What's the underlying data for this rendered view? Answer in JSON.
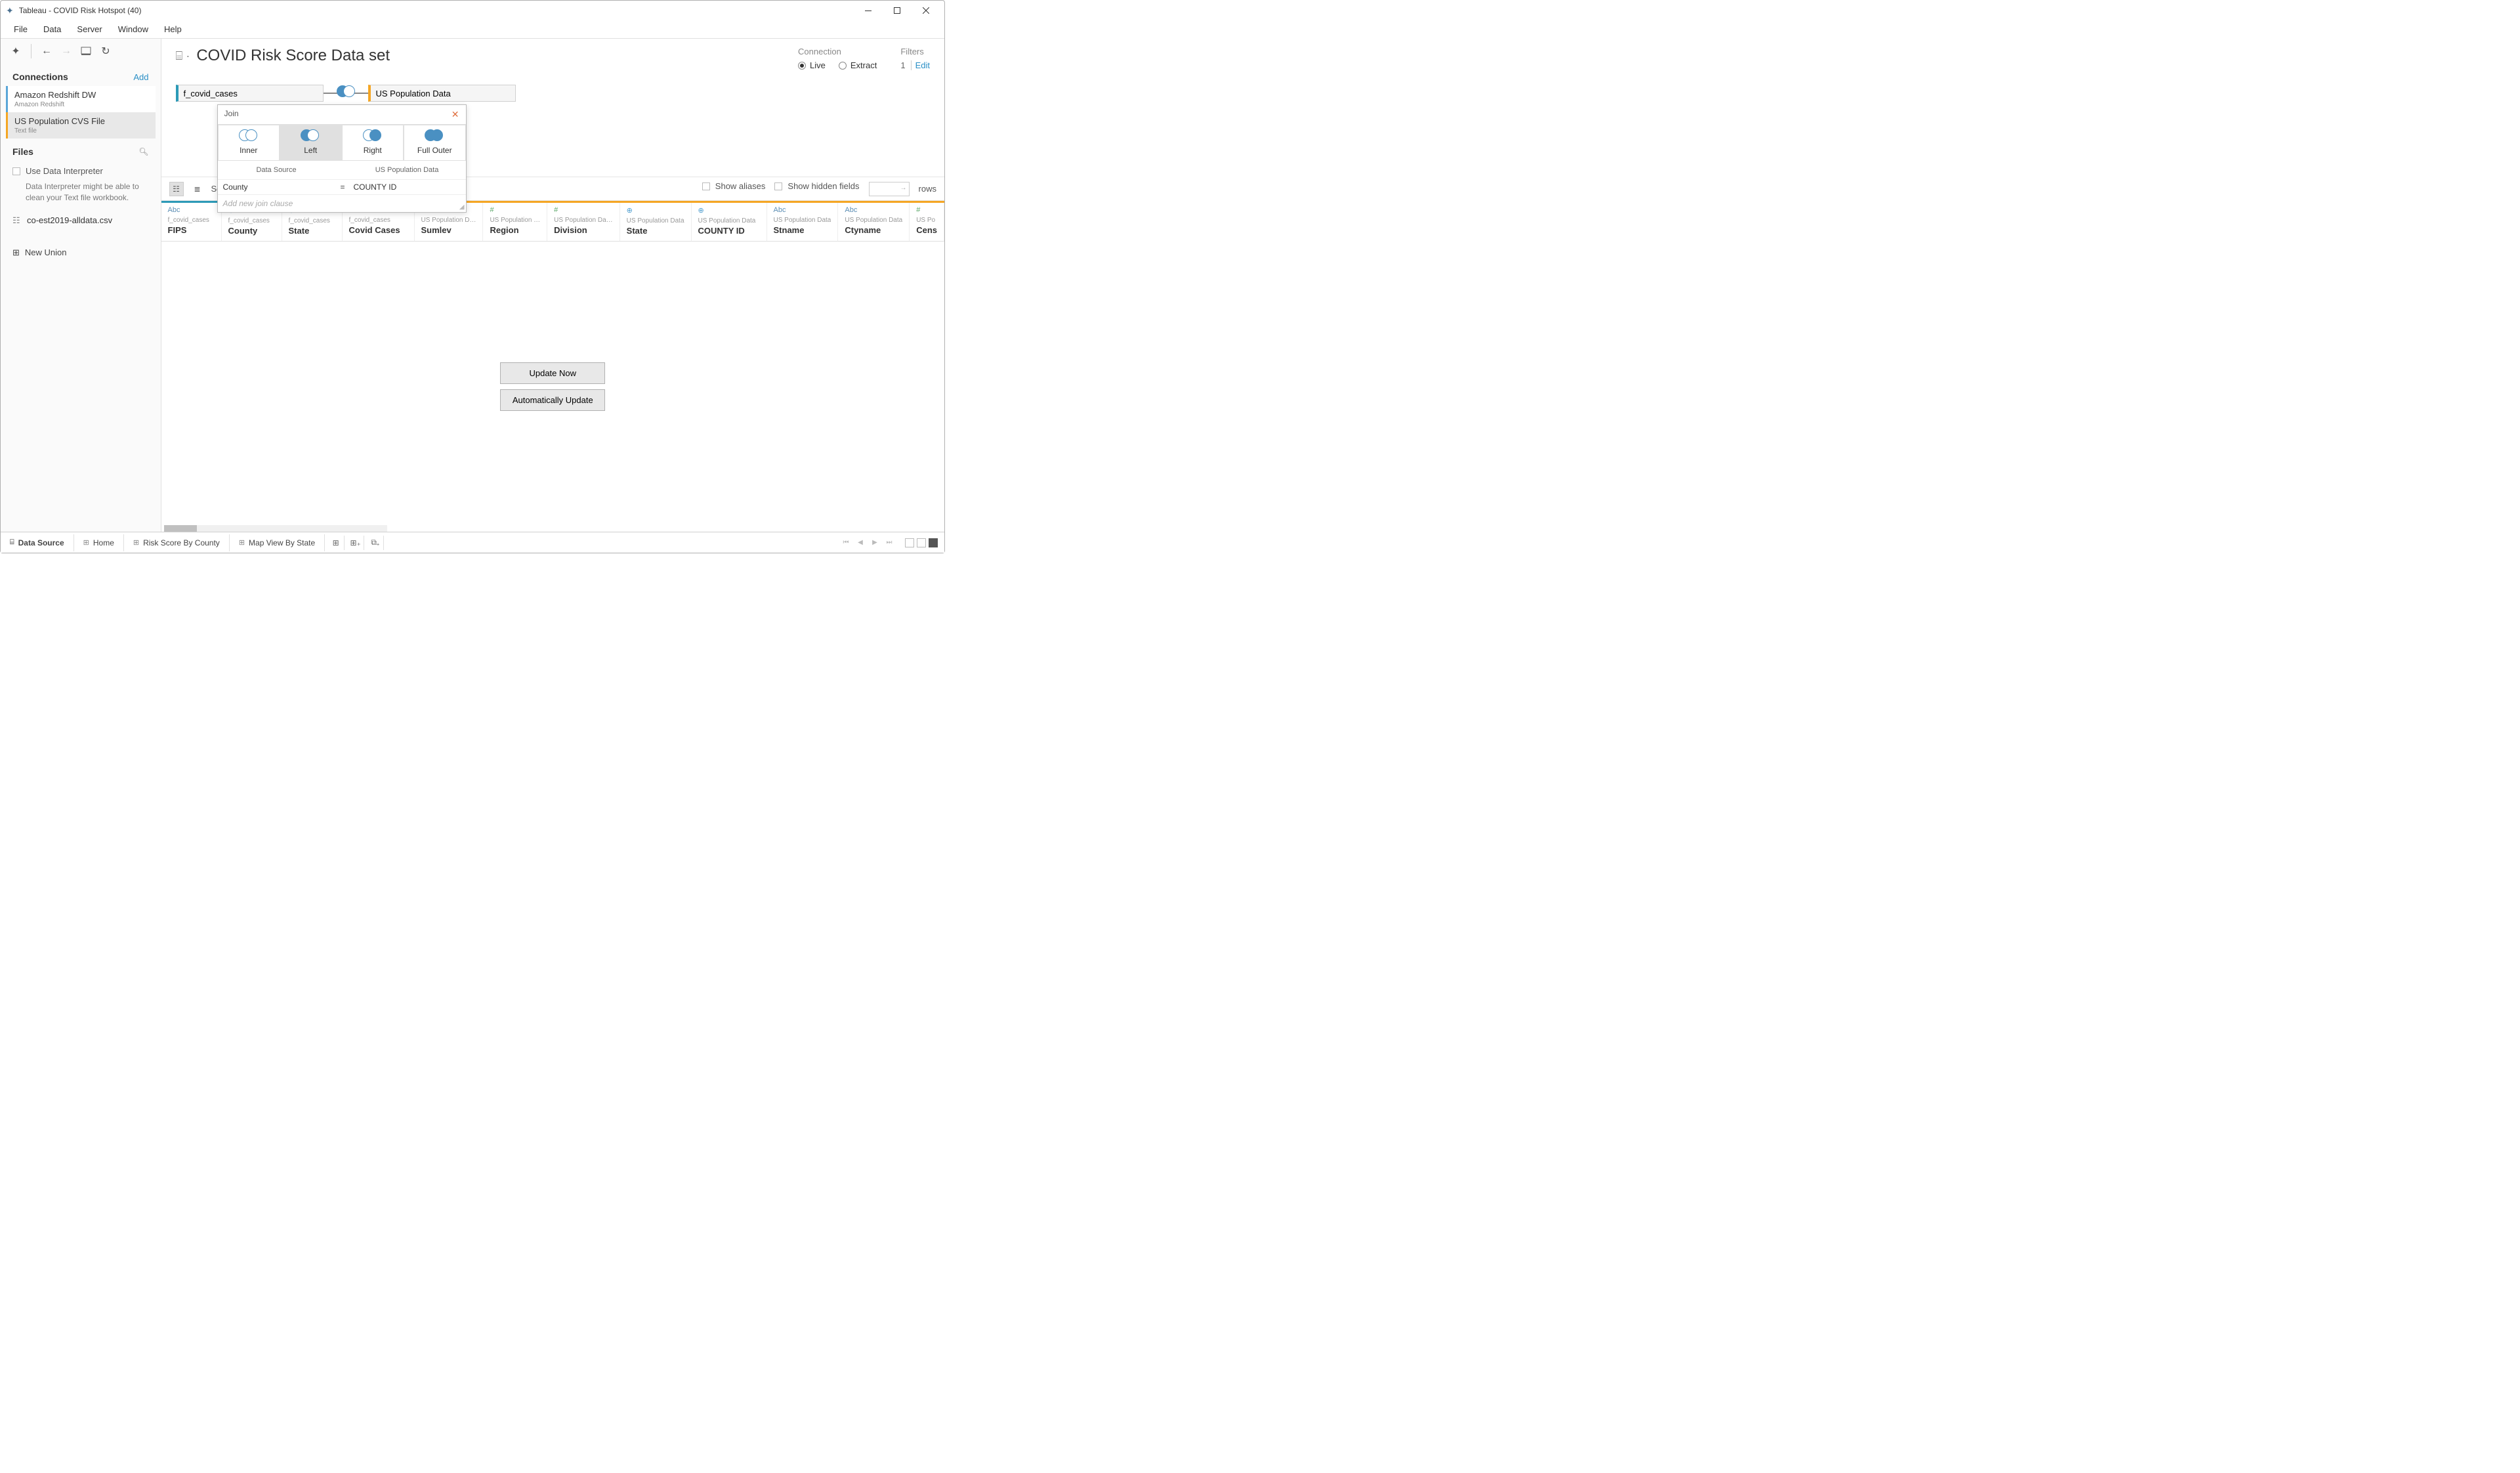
{
  "titlebar": {
    "title": "Tableau - COVID Risk Hotspot (40)"
  },
  "menubar": [
    "File",
    "Data",
    "Server",
    "Window",
    "Help"
  ],
  "sidebar": {
    "connections": {
      "title": "Connections",
      "add": "Add",
      "items": [
        {
          "name": "Amazon Redshift DW",
          "type": "Amazon Redshift"
        },
        {
          "name": "US Population CVS File",
          "type": "Text file"
        }
      ]
    },
    "files": {
      "title": "Files",
      "interpreter_label": "Use Data Interpreter",
      "interpreter_hint": "Data Interpreter might be able to clean your Text file workbook.",
      "items": [
        "co-est2019-alldata.csv"
      ]
    },
    "new_union": "New Union"
  },
  "datasource": {
    "title": "COVID Risk Score Data set",
    "connection_label": "Connection",
    "live": "Live",
    "extract": "Extract",
    "filters_label": "Filters",
    "filter_count": "1",
    "filter_edit": "Edit"
  },
  "tables": {
    "t1": "f_covid_cases",
    "t2": "US Population Data"
  },
  "join_popup": {
    "title": "Join",
    "types": [
      "Inner",
      "Left",
      "Right",
      "Full Outer"
    ],
    "header_l": "Data Source",
    "header_r": "US Population Data",
    "field_l": "County",
    "op": "=",
    "field_r": "COUNTY ID",
    "add_clause": "Add new join clause"
  },
  "grid_toolbar": {
    "sort_label": "Sort",
    "show_aliases": "Show aliases",
    "show_hidden": "Show hidden fields",
    "rows_label": "rows"
  },
  "columns": [
    {
      "type": "abc",
      "src": "f_covid_cases",
      "name": "FIPS"
    },
    {
      "type": "globe",
      "src": "f_covid_cases",
      "name": "County"
    },
    {
      "type": "globe",
      "src": "f_covid_cases",
      "name": "State"
    },
    {
      "type": "hash",
      "src": "f_covid_cases",
      "name": "Covid Cases"
    },
    {
      "type": "hash",
      "src": "US Population D…",
      "name": "Sumlev"
    },
    {
      "type": "hash",
      "src": "US Population …",
      "name": "Region"
    },
    {
      "type": "hash",
      "src": "US Population Da…",
      "name": "Division"
    },
    {
      "type": "globe",
      "src": "US Population Data",
      "name": "State"
    },
    {
      "type": "globe",
      "src": "US Population Data",
      "name": "COUNTY ID"
    },
    {
      "type": "abc",
      "src": "US Population Data",
      "name": "Stname"
    },
    {
      "type": "abc",
      "src": "US Population Data",
      "name": "Ctyname"
    },
    {
      "type": "hash",
      "src": "US Po",
      "name": "Cens"
    }
  ],
  "updates": {
    "now": "Update Now",
    "auto": "Automatically Update"
  },
  "bottom": {
    "data_source": "Data Source",
    "tabs": [
      "Home",
      "Risk Score By County",
      "Map View By State"
    ]
  }
}
